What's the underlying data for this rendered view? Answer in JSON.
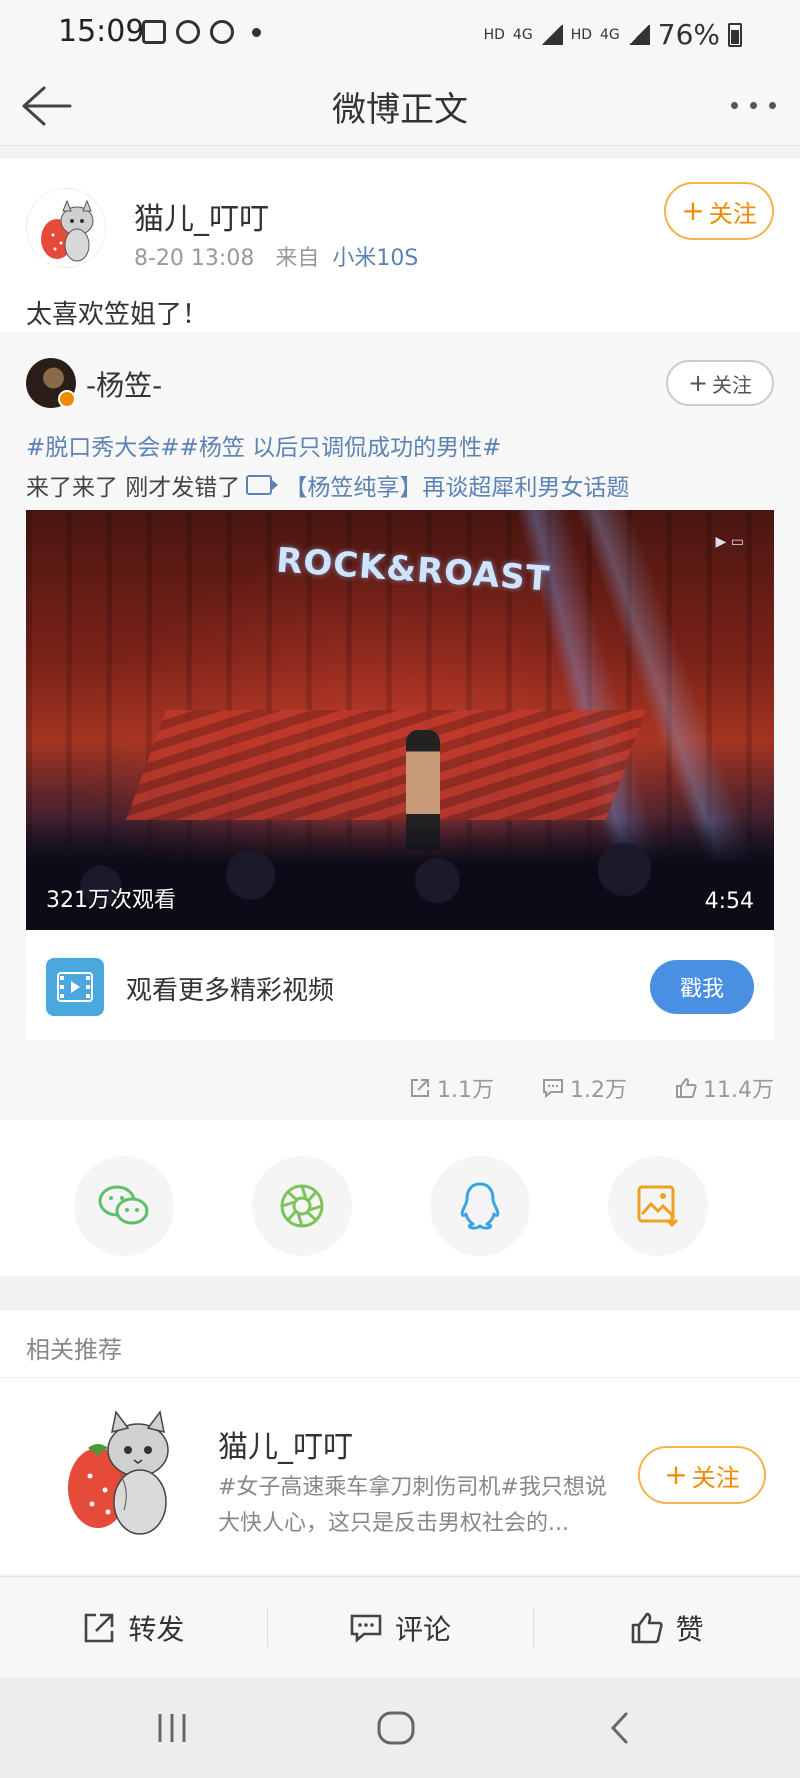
{
  "status_bar": {
    "time": "15:09",
    "hd1": "HD",
    "net1": "4G",
    "hd2": "HD",
    "net2": "4G",
    "battery": "76%"
  },
  "nav": {
    "title": "微博正文"
  },
  "post": {
    "author_name": "猫儿_叮叮",
    "time": "8-20 13:08",
    "source_prefix": "来自",
    "source": "小米10S",
    "follow_label": "关注",
    "text": "太喜欢笠姐了！"
  },
  "repost": {
    "author_name": "-杨笠-",
    "follow_label": "关注",
    "tags": "#脱口秀大会##杨笠 以后只调侃成功的男性#",
    "text_prefix": "来了来了 刚才发错了",
    "link_text": "【杨笠纯享】再谈超犀利男女话题",
    "video": {
      "sign_text": "ROCK&ROAST",
      "views": "321万次观看",
      "duration": "4:54"
    },
    "more_video": {
      "text": "观看更多精彩视频",
      "button": "戳我"
    },
    "stats": {
      "reposts": "1.1万",
      "comments": "1.2万",
      "likes": "11.4万"
    }
  },
  "share": {
    "items": [
      "wechat-icon",
      "moments-icon",
      "qq-icon",
      "save-image-icon"
    ]
  },
  "related": {
    "title": "相关推荐",
    "name": "猫儿_叮叮",
    "desc": "#女子高速乘车拿刀刺伤司机#我只想说大快人心，这只是反击男权社会的...",
    "follow_label": "关注"
  },
  "actions": {
    "repost": "转发",
    "comment": "评论",
    "like": "赞"
  },
  "colors": {
    "accent_orange": "#f08a00",
    "link_blue": "#5b83b5",
    "button_blue": "#4a90e2"
  }
}
